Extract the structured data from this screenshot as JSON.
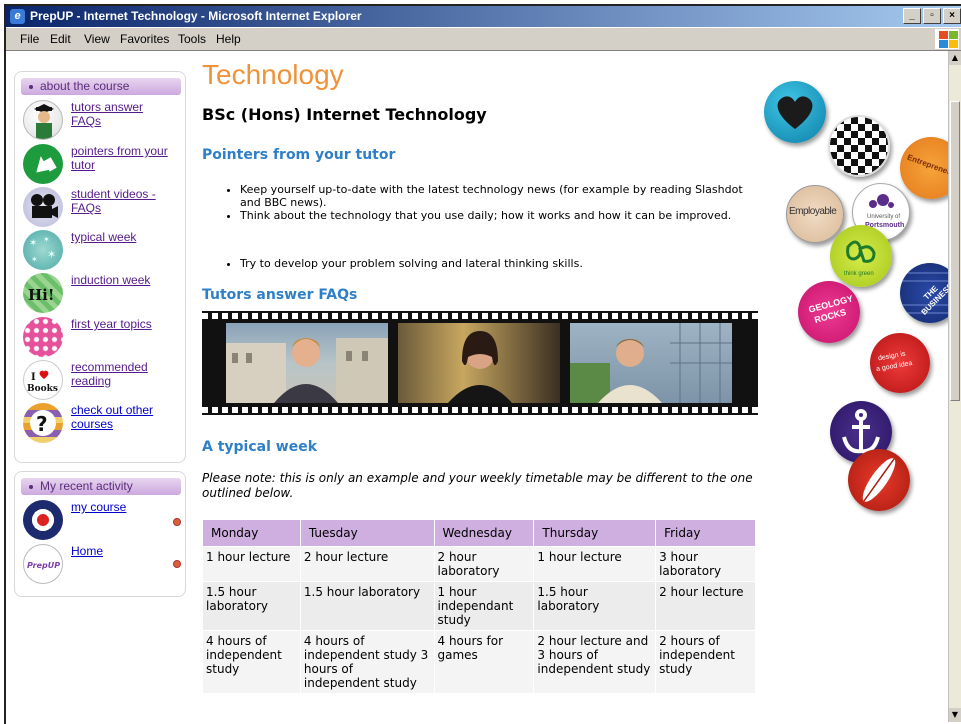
{
  "window": {
    "title": "PrepUP - Internet Technology - Microsoft Internet Explorer",
    "menu": [
      "File",
      "Edit",
      "View",
      "Favorites",
      "Tools",
      "Help"
    ]
  },
  "sidebar": {
    "about_title": "about the course",
    "items": [
      {
        "label": "tutors answer FAQs",
        "icon": "graduate-icon"
      },
      {
        "label": "pointers from your tutor",
        "icon": "arrow-icon"
      },
      {
        "label": "student videos -FAQs",
        "icon": "film-camera-icon"
      },
      {
        "label": "typical week",
        "icon": "stars-icon"
      },
      {
        "label": "induction week",
        "icon": "hi-icon"
      },
      {
        "label": "first year topics",
        "icon": "polka-dot-icon"
      },
      {
        "label": "recommended reading",
        "icon": "books-icon",
        "icon_text_top": "I",
        "icon_text_bottom": "Books"
      },
      {
        "label": "check out other courses",
        "icon": "question-icon"
      }
    ],
    "activity_title": "My recent activity",
    "activity": [
      {
        "label": "my course",
        "icon": "target-icon"
      },
      {
        "label": "Home",
        "icon": "prepup-icon",
        "icon_text": "PrepUP"
      }
    ]
  },
  "main": {
    "heading": "Technology",
    "subheading": "BSc (Hons) Internet Technology",
    "pointers_heading": "Pointers from your tutor",
    "pointers": [
      "Keep yourself up-to-date with the latest technology news (for example by reading Slashdot and BBC news).",
      "Think about the technology that you use daily; how it works and how it can be improved.",
      "Try to develop your problem solving and lateral thinking skills."
    ],
    "faq_heading": "Tutors answer FAQs",
    "week_heading": "A typical week",
    "note": "Please note: this is only an example and your weekly timetable may be different to the one outlined below.",
    "timetable": {
      "headers": [
        "Monday",
        "Tuesday",
        "Wednesday",
        "Thursday",
        "Friday"
      ],
      "rows": [
        [
          "1 hour lecture",
          "2 hour lecture",
          "2 hour laboratory",
          "1 hour lecture",
          "3 hour laboratory"
        ],
        [
          "1.5 hour laboratory",
          "1.5 hour laboratory",
          "1 hour independant study",
          "1.5 hour laboratory",
          "2 hour lecture"
        ],
        [
          "4 hours of independent study",
          "4 hours of independent study 3 hours of independent study",
          "4 hours for games",
          "2 hour lecture and 3 hours of independent study",
          "2 hours of independent study"
        ]
      ]
    }
  },
  "badges": {
    "entrepreneur": "Entrepreneur",
    "employable": "Employable",
    "university_top": "University of",
    "university_bottom": "Portsmouth",
    "think_green": "think green",
    "the_business": "THE BUSINESS",
    "geology_top": "GEOLOGY",
    "geology_bottom": "ROCKS",
    "design_top": "design is",
    "design_bottom": "a good idea"
  },
  "colors": {
    "heading": "#f0923a",
    "section": "#2f7fc8",
    "panel_head": "#cca8df",
    "table_header": "#cfaee0"
  }
}
